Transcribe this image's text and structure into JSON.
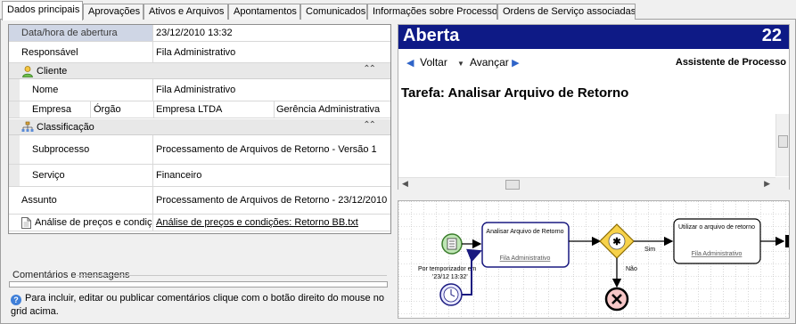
{
  "tabs": [
    {
      "label": "Dados principais",
      "active": true
    },
    {
      "label": "Aprovações"
    },
    {
      "label": "Ativos e Arquivos"
    },
    {
      "label": "Apontamentos"
    },
    {
      "label": "Comunicados"
    },
    {
      "label": "Informações sobre Processo"
    },
    {
      "label": "Ordens de Serviço associadas"
    }
  ],
  "grid": {
    "opened_label": "Data/hora de abertura",
    "opened_value": "23/12/2010 13:32",
    "responsible_label": "Responsável",
    "responsible_value": "Fila Administrativo",
    "client_category": "Cliente",
    "name_label": "Nome",
    "name_value": "Fila Administrativo",
    "company_label": "Empresa",
    "org_label": "Órgão",
    "company_value": "Empresa LTDA",
    "org_value": "Gerência Administrativa",
    "class_category": "Classificação",
    "subprocess_label": "Subprocesso",
    "subprocess_value": "Processamento de Arquivos de Retorno - Versão 1",
    "service_label": "Serviço",
    "service_value": "Financeiro",
    "subject_label": "Assunto",
    "subject_value": "Processamento de Arquivos de Retorno - 23/12/2010",
    "attachment_label": "Análise de preços e condiçõ",
    "attachment_value": "Análise de preços e condições: Retorno BB.txt"
  },
  "comments": {
    "title": "Comentários e mensagens",
    "hint": "Para incluir, editar ou publicar comentários clique com o botão direito do mouse no grid acima."
  },
  "process": {
    "status": "Aberta",
    "number": "22",
    "back_label": "Voltar",
    "forward_label": "Avançar",
    "assistant_title": "Assistente de Processo",
    "task": "Tarefa: Analisar Arquivo de Retorno"
  },
  "diagram": {
    "task1_title": "Analisar Arquivo de Retorno",
    "task1_assignee": "Fila Administrativo",
    "task2_title": "Utilizar o arquivo de retorno",
    "task2_assignee": "Fila Administrativo",
    "timer_label_1": "Por temporizador em",
    "timer_label_2": "'23/12 13:32'",
    "yes_label": "Sim",
    "no_label": "Não"
  },
  "colors": {
    "header_bg": "#0e1a86",
    "selected_row": "#cfd6e5",
    "nav_arrow": "#2f64c8"
  }
}
